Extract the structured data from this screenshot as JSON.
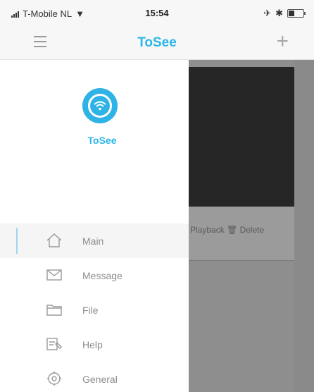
{
  "status_bar": {
    "carrier": "T-Mobile NL",
    "time": "15:54"
  },
  "nav": {
    "title": "ToSee",
    "add_icon": "plus-icon",
    "menu_icon": "hamburger-icon"
  },
  "drawer": {
    "brand_name": "ToSee",
    "logo_icon": "tosee-logo",
    "accent_color": "#2bb6e8",
    "items": [
      {
        "label": "Main",
        "icon": "home-icon",
        "active": true
      },
      {
        "label": "Message",
        "icon": "envelope-icon",
        "active": false
      },
      {
        "label": "File",
        "icon": "folder-icon",
        "active": false
      },
      {
        "label": "Help",
        "icon": "help-icon",
        "active": false
      },
      {
        "label": "General",
        "icon": "gear-icon",
        "active": false
      }
    ]
  },
  "background": {
    "actions_label": "Playback 🗑 Delete"
  }
}
